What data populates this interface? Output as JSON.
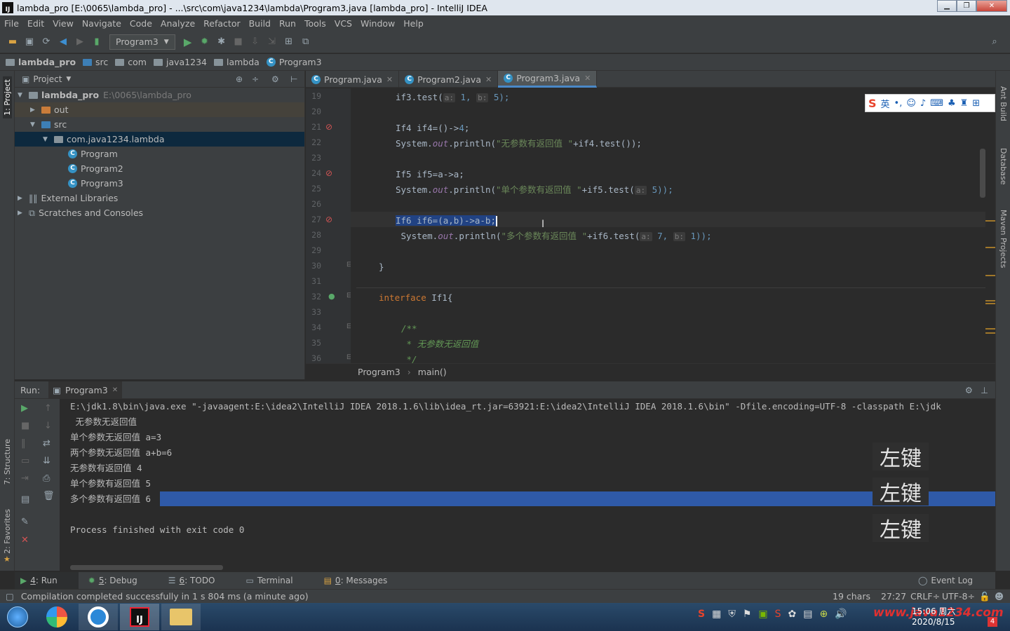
{
  "window": {
    "title": "lambda_pro [E:\\0065\\lambda_pro] - ...\\src\\com\\java1234\\lambda\\Program3.java [lambda_pro] - IntelliJ IDEA"
  },
  "menu": [
    "File",
    "Edit",
    "View",
    "Navigate",
    "Code",
    "Analyze",
    "Refactor",
    "Build",
    "Run",
    "Tools",
    "VCS",
    "Window",
    "Help"
  ],
  "toolbar": {
    "run_config": "Program3"
  },
  "breadcrumb": [
    "lambda_pro",
    "src",
    "com",
    "java1234",
    "lambda",
    "Program3"
  ],
  "project_panel": {
    "title": "Project",
    "root_name": "lambda_pro",
    "root_path": "E:\\0065\\lambda_pro",
    "items": [
      {
        "label": "out"
      },
      {
        "label": "src"
      },
      {
        "label": "com.java1234.lambda"
      },
      {
        "label": "Program"
      },
      {
        "label": "Program2"
      },
      {
        "label": "Program3"
      },
      {
        "label": "External Libraries"
      },
      {
        "label": "Scratches and Consoles"
      }
    ]
  },
  "left_strip": {
    "project": "1: Project",
    "structure": "7: Structure",
    "favorites": "2: Favorites"
  },
  "right_strip": {
    "ant": "Ant Build",
    "database": "Database",
    "maven": "Maven Projects"
  },
  "editor_tabs": [
    "Program.java",
    "Program2.java",
    "Program3.java"
  ],
  "editor": {
    "line_numbers": [
      "19",
      "20",
      "21",
      "22",
      "23",
      "24",
      "25",
      "26",
      "27",
      "28",
      "29",
      "30",
      "31",
      "32",
      "33",
      "34",
      "35",
      "36"
    ],
    "code": {
      "l19a": "if3.test(",
      "l19h1": "a:",
      "l19b": " 1, ",
      "l19h2": "b:",
      "l19c": " 5);",
      "l21a": "If4 if4=()->",
      "l21b": "4",
      "l21c": ";",
      "l22a": "System.",
      "l22b": "out",
      "l22c": ".println(",
      "l22d": "\"无参数有返回值 \"",
      "l22e": "+if4.test());",
      "l24": "If5 if5=a->a;",
      "l25a": "System.",
      "l25b": "out",
      "l25c": ".println(",
      "l25d": "\"单个参数有返回值 \"",
      "l25e": "+if5.test(",
      "l25h": "a:",
      "l25f": " 5));",
      "l27": "If6 if6=(a,b)->a-b;",
      "l28a": " System.",
      "l28b": "out",
      "l28c": ".println(",
      "l28d": "\"多个参数有返回值 \"",
      "l28e": "+if6.test(",
      "l28h1": "a:",
      "l28f": " 7, ",
      "l28h2": "b:",
      "l28g": " 1));",
      "l30": "}",
      "l32a": "interface",
      "l32b": " If1{",
      "l34": "/**",
      "l35": " * 无参数无返回值",
      "l36": " */"
    },
    "breadcrumb": [
      "Program3",
      "main()"
    ]
  },
  "ime_toolbar": {
    "lang": "英"
  },
  "run_panel": {
    "label": "Run:",
    "tab": "Program3",
    "lines": [
      "E:\\jdk1.8\\bin\\java.exe \"-javaagent:E:\\idea2\\IntelliJ IDEA 2018.1.6\\lib\\idea_rt.jar=63921:E:\\idea2\\IntelliJ IDEA 2018.1.6\\bin\" -Dfile.encoding=UTF-8 -classpath E:\\jdk",
      " 无参数无返回值",
      "单个参数无返回值 a=3",
      "两个参数无返回值 a+b=6",
      "无参数有返回值 4",
      "单个参数有返回值 5",
      "多个参数有返回值 6",
      "",
      "Process finished with exit code 0"
    ],
    "key_overlays": [
      "左键",
      "左键",
      "左键"
    ]
  },
  "bottom_tabs": [
    {
      "num": "4",
      "label": ": Run"
    },
    {
      "num": "5",
      "label": ": Debug"
    },
    {
      "num": "6",
      "label": ": TODO"
    },
    {
      "num": "",
      "label": "Terminal"
    },
    {
      "num": "0",
      "label": ": Messages"
    }
  ],
  "event_log": "Event Log",
  "status": {
    "message": "Compilation completed successfully in 1 s 804 ms (a minute ago)",
    "chars": "19 chars",
    "position": "27:27",
    "line_sep": "CRLF÷",
    "encoding": "UTF-8÷"
  },
  "taskbar": {
    "time": "15:06 周六",
    "date": "2020/8/15",
    "watermark": "www.java1234.com",
    "badge": "4"
  },
  "colors": {
    "accent": "#4a88c7",
    "selection": "#214283",
    "console_selection": "#2f5aa8",
    "keyword": "#cc7832",
    "string": "#6a8759"
  }
}
